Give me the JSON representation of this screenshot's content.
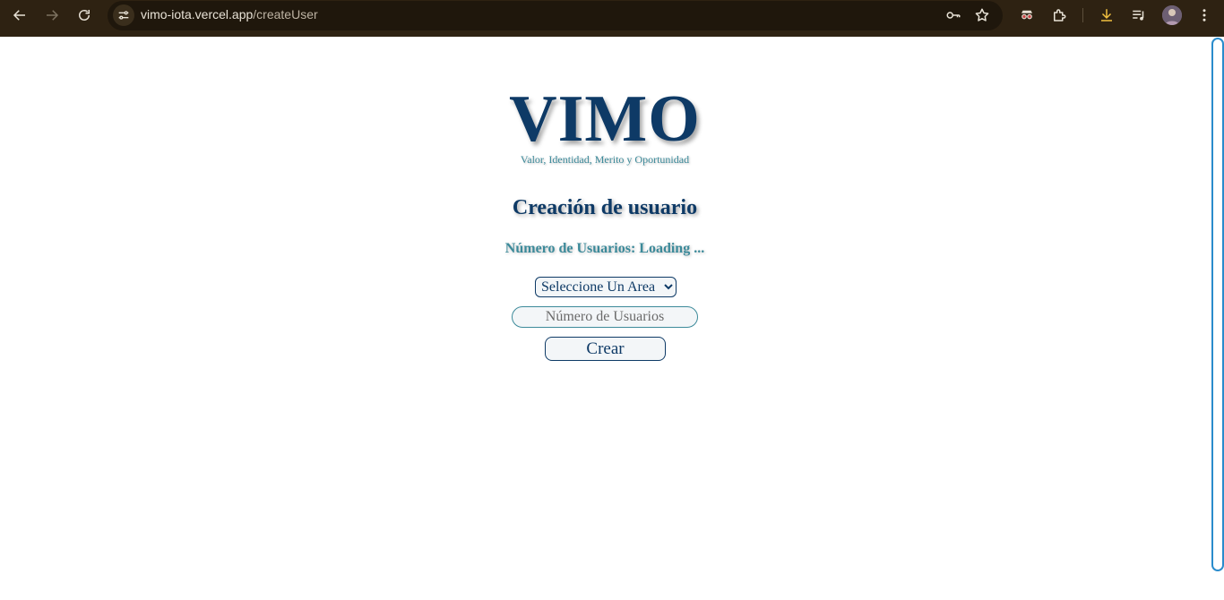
{
  "browser": {
    "url_host": "vimo-iota.vercel.app",
    "url_path": "/createUser",
    "icons": [
      "back-arrow-icon",
      "forward-arrow-icon",
      "reload-icon",
      "site-info-icon",
      "key-icon",
      "star-icon",
      "incognito-glasses-icon",
      "puzzle-extension-icon",
      "download-icon",
      "media-queue-icon",
      "avatar",
      "kebab-menu-icon"
    ]
  },
  "page": {
    "logo": "VIMO",
    "tagline": "Valor, Identidad, Merito y Oportunidad",
    "heading": "Creación de usuario",
    "count_label": "Número de Usuarios:",
    "count_value": "Loading ...",
    "area_select": {
      "selected": "Seleccione Un Area"
    },
    "quantity_input": {
      "placeholder": "Número de Usuarios",
      "value": ""
    },
    "create_button": "Crear"
  },
  "colors": {
    "chrome_bg": "#2e2212",
    "primary": "#0e3a66",
    "accent": "#3c8a9a",
    "scrollbar": "#2a8ccc"
  }
}
